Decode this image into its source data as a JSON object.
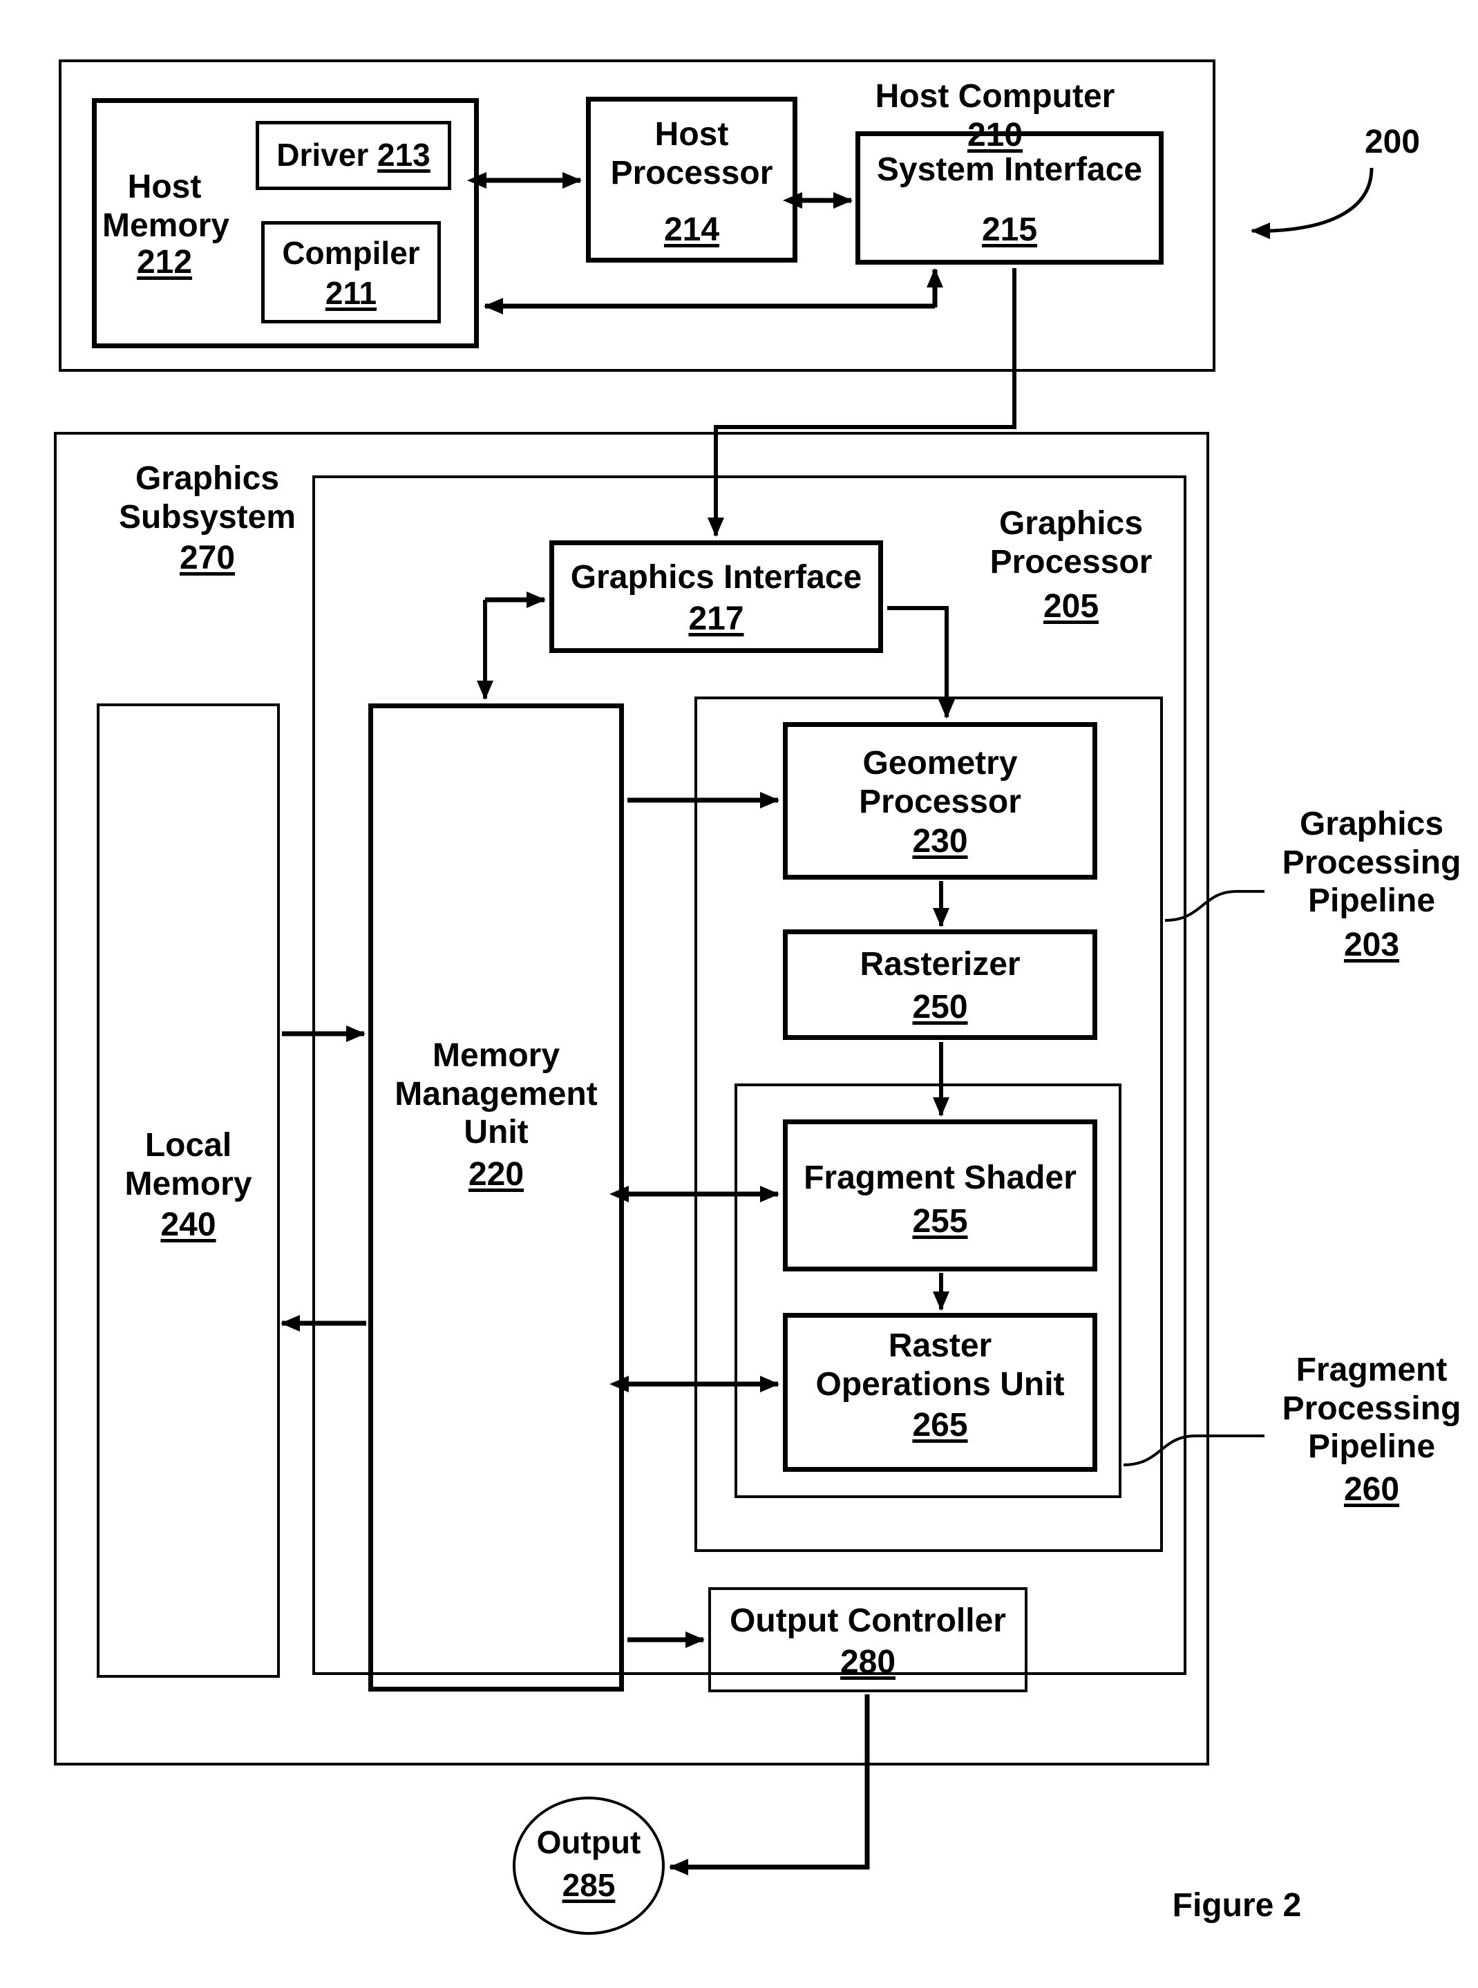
{
  "figure": {
    "caption": "Figure 2",
    "system_ref": "200"
  },
  "host_computer": {
    "title": "Host Computer",
    "ref": "210",
    "host_memory": {
      "title": "Host\nMemory",
      "ref": "212"
    },
    "driver": {
      "title": "Driver",
      "ref": "213"
    },
    "compiler": {
      "title": "Compiler",
      "ref": "211"
    },
    "host_processor": {
      "title": "Host\nProcessor",
      "ref": "214"
    },
    "system_interface": {
      "title": "System Interface",
      "ref": "215"
    }
  },
  "graphics_subsystem": {
    "title": "Graphics\nSubsystem",
    "ref": "270",
    "graphics_processor": {
      "title": "Graphics\nProcessor",
      "ref": "205"
    },
    "graphics_interface": {
      "title": "Graphics Interface",
      "ref": "217"
    },
    "local_memory": {
      "title": "Local\nMemory",
      "ref": "240"
    },
    "memory_management_unit": {
      "title": "Memory\nManagement\nUnit",
      "ref": "220"
    },
    "graphics_processing_pipeline": {
      "title": "Graphics\nProcessing\nPipeline",
      "ref": "203"
    },
    "geometry_processor": {
      "title": "Geometry\nProcessor",
      "ref": "230"
    },
    "rasterizer": {
      "title": "Rasterizer",
      "ref": "250"
    },
    "fragment_processing_pipeline": {
      "title": "Fragment\nProcessing\nPipeline",
      "ref": "260"
    },
    "fragment_shader": {
      "title": "Fragment Shader",
      "ref": "255"
    },
    "raster_operations_unit": {
      "title": "Raster\nOperations Unit",
      "ref": "265"
    },
    "output_controller": {
      "title": "Output Controller",
      "ref": "280"
    }
  },
  "output": {
    "title": "Output",
    "ref": "285"
  },
  "colors": {
    "stroke": "#000000",
    "background": "#ffffff"
  }
}
